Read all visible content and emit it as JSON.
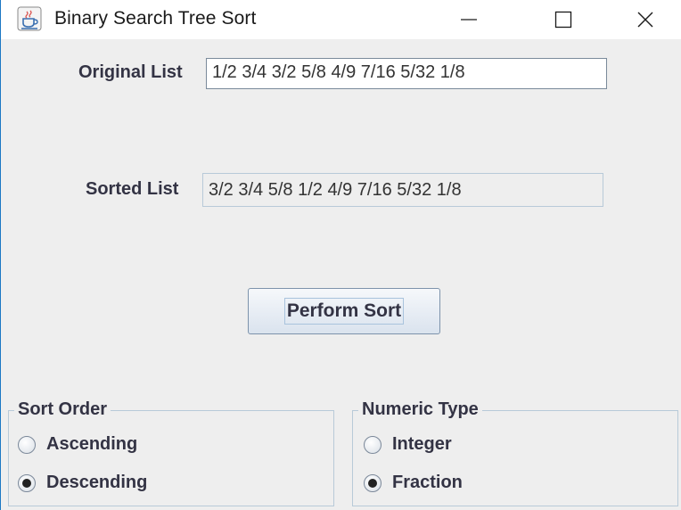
{
  "window": {
    "title": "Binary Search Tree Sort",
    "icon": "java-cup-icon"
  },
  "original": {
    "label": "Original List",
    "value": "1/2 3/4 3/2 5/8 4/9 7/16 5/32 1/8"
  },
  "sorted": {
    "label": "Sorted List",
    "value": "3/2 3/4 5/8 1/2 4/9 7/16 5/32 1/8"
  },
  "perform_button": "Perform Sort",
  "sort_order": {
    "title": "Sort Order",
    "options": [
      "Ascending",
      "Descending"
    ],
    "selected": "Descending"
  },
  "numeric_type": {
    "title": "Numeric Type",
    "options": [
      "Integer",
      "Fraction"
    ],
    "selected": "Fraction"
  },
  "colors": {
    "window_bg": "#eeeeee",
    "text": "#333344",
    "border_accent": "#1c78c4"
  }
}
